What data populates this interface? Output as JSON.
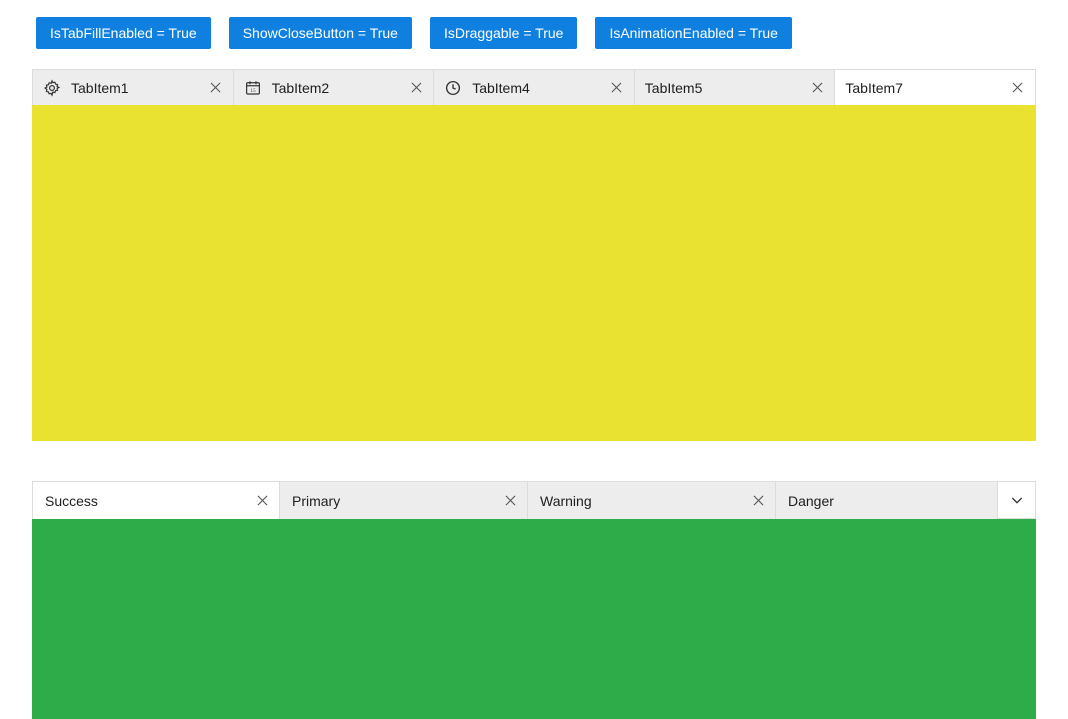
{
  "buttons": {
    "tabfill": "IsTabFillEnabled = True",
    "closebtn": "ShowCloseButton = True",
    "draggable": "IsDraggable = True",
    "animation": "IsAnimationEnabled = True"
  },
  "tabs1": {
    "items": [
      {
        "label": "TabItem1",
        "icon": "settings",
        "closeable": true,
        "selected": false
      },
      {
        "label": "TabItem2",
        "icon": "calendar",
        "closeable": true,
        "selected": false
      },
      {
        "label": "TabItem4",
        "icon": "clock",
        "closeable": true,
        "selected": false
      },
      {
        "label": "TabItem5",
        "icon": "",
        "closeable": true,
        "selected": false
      },
      {
        "label": "TabItem7",
        "icon": "",
        "closeable": true,
        "selected": true
      }
    ],
    "content_color": "#e9e231"
  },
  "tabs2": {
    "items": [
      {
        "label": "Success",
        "closeable": true,
        "selected": true
      },
      {
        "label": "Primary",
        "closeable": true,
        "selected": false
      },
      {
        "label": "Warning",
        "closeable": true,
        "selected": false
      },
      {
        "label": "Danger",
        "closeable": false,
        "selected": false
      }
    ],
    "overflow": true,
    "content_color": "#2fac4a"
  }
}
